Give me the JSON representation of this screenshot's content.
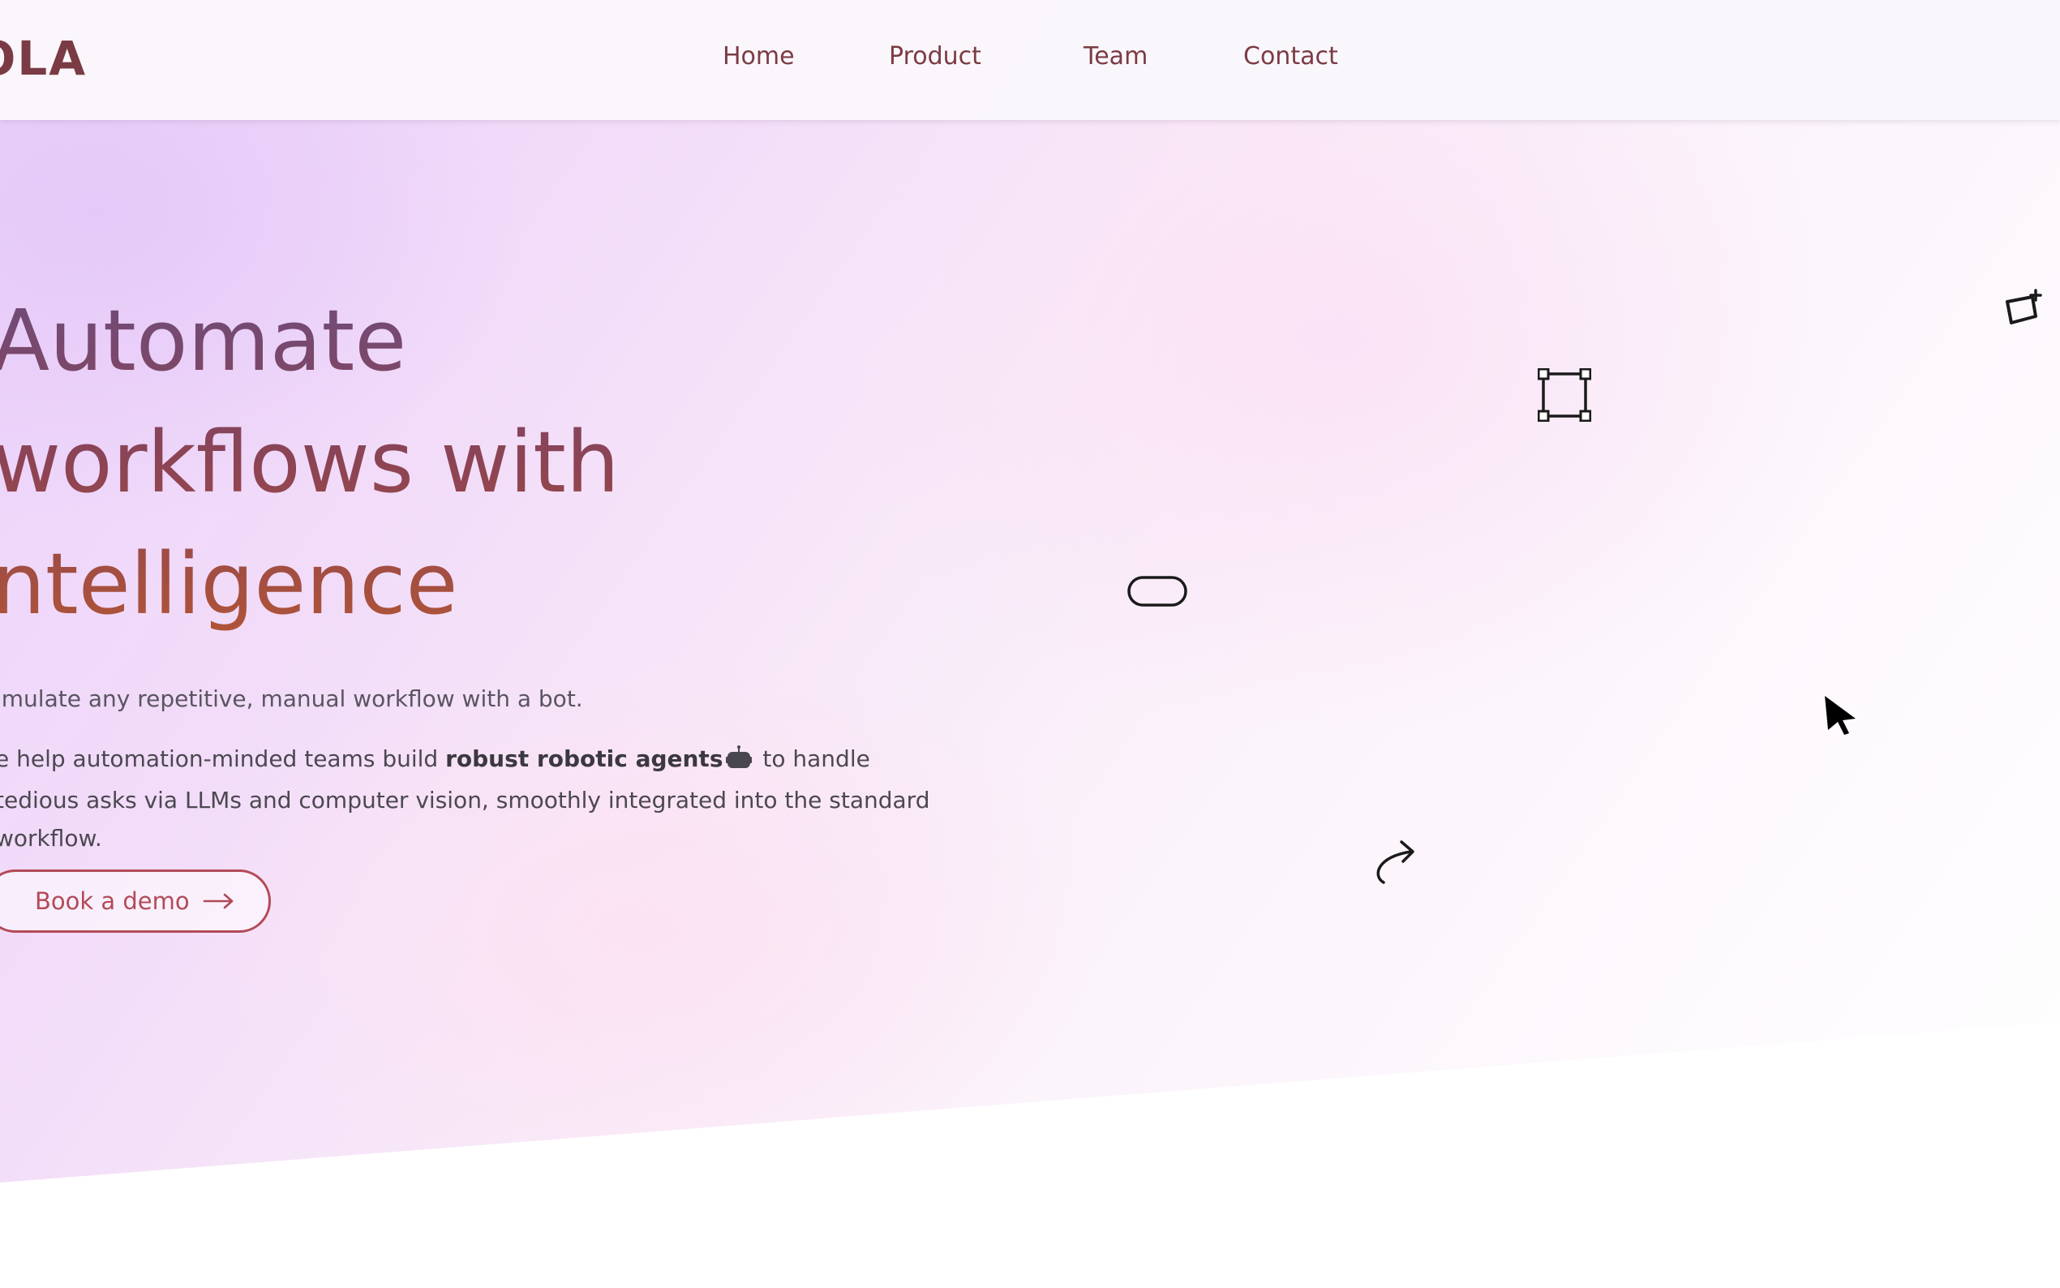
{
  "header": {
    "logo_text": "OLA",
    "nav": [
      {
        "label": "Home"
      },
      {
        "label": "Product"
      },
      {
        "label": "Team"
      },
      {
        "label": "Contact"
      }
    ]
  },
  "hero": {
    "headline_lines": [
      "Automate",
      "workflows with",
      "ntelligence"
    ],
    "sub1": "imulate any repetitive, manual workflow with a bot.",
    "sub2_before": "e help automation-minded teams build ",
    "sub2_bold": "robust robotic agents",
    "sub2_after": " to handle tedious asks via LLMs and computer vision, smoothly integrated into the standard workflow.",
    "cta_label": "Book a demo"
  },
  "icons": {
    "robot": "robot-icon",
    "cta_arrow": "arrow-right-icon",
    "floating": [
      "frame-select-icon",
      "sparkle-tag-icon",
      "pill-shape-icon",
      "cursor-pointer-icon",
      "redo-curve-arrow-icon"
    ]
  },
  "colors": {
    "brand": "#7b3b44",
    "accent": "#b34a58",
    "headline_gradient": [
      "#6d4c7c",
      "#8c4354",
      "#b25536"
    ]
  }
}
